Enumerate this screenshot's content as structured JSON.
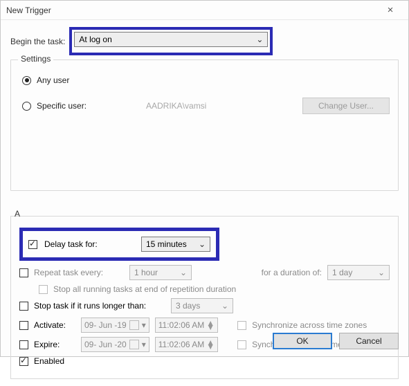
{
  "window": {
    "title": "New Trigger"
  },
  "begin": {
    "label": "Begin the task:",
    "selected": "At log on"
  },
  "settings": {
    "legend": "Settings",
    "any_user_label": "Any user",
    "specific_user_label": "Specific user:",
    "specific_user_value": "AADRIKA\\vamsi",
    "change_user_btn": "Change User..."
  },
  "advanced": {
    "legend_hidden_prefix": "A",
    "delay": {
      "label": "Delay task for:",
      "value": "15 minutes"
    },
    "repeat": {
      "label": "Repeat task every:",
      "value": "1 hour",
      "duration_label": "for a duration of:",
      "duration_value": "1 day"
    },
    "stop_at_end_label": "Stop all running tasks at end of repetition duration",
    "stop_if_label": "Stop task if it runs longer than:",
    "stop_if_value": "3 days",
    "activate": {
      "label": "Activate:",
      "date": "09- Jun -19",
      "time": "11:02:06 AM",
      "sync_label": "Synchronize across time zones"
    },
    "expire": {
      "label": "Expire:",
      "date": "09- Jun -20",
      "time": "11:02:06 AM",
      "sync_label": "Synchronize across time zones"
    },
    "enabled_label": "Enabled"
  },
  "footer": {
    "ok": "OK",
    "cancel": "Cancel"
  }
}
